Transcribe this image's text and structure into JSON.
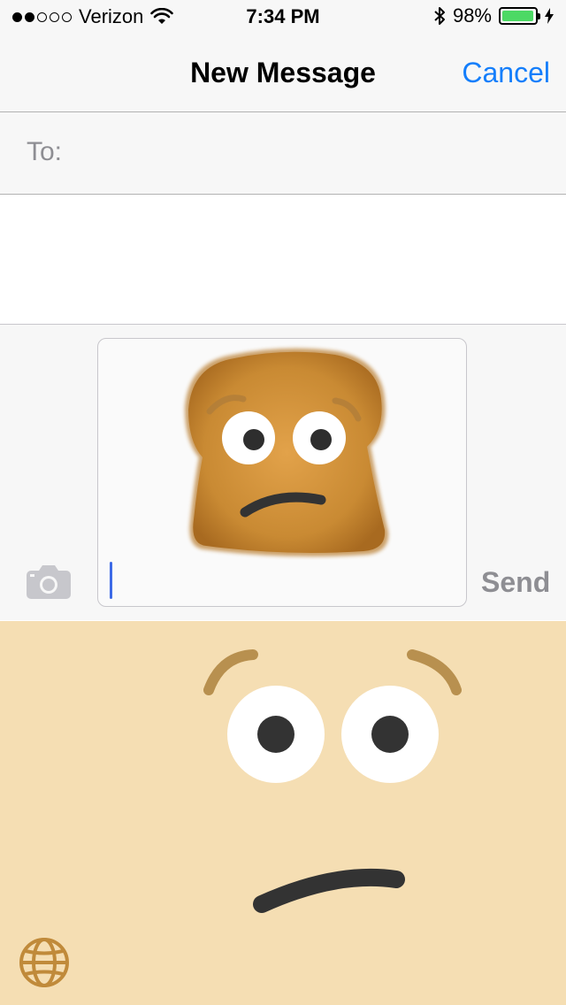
{
  "status_bar": {
    "carrier": "Verizon",
    "signal_bars_filled": 2,
    "signal_bars_total": 5,
    "time": "7:34 PM",
    "battery_percent": "98%",
    "battery_level": 0.98
  },
  "nav": {
    "title": "New Message",
    "cancel_label": "Cancel"
  },
  "recipients": {
    "to_label": "To:"
  },
  "composer": {
    "send_label": "Send",
    "attachment": "toast-face-sticker"
  },
  "keyboard": {
    "globe": "globe-icon"
  },
  "colors": {
    "accent": "#147efb",
    "keyboard_bg": "#f5deb3",
    "battery_fill": "#4cd964",
    "cursor": "#3d6ae6",
    "send_disabled": "#8e8e93"
  }
}
